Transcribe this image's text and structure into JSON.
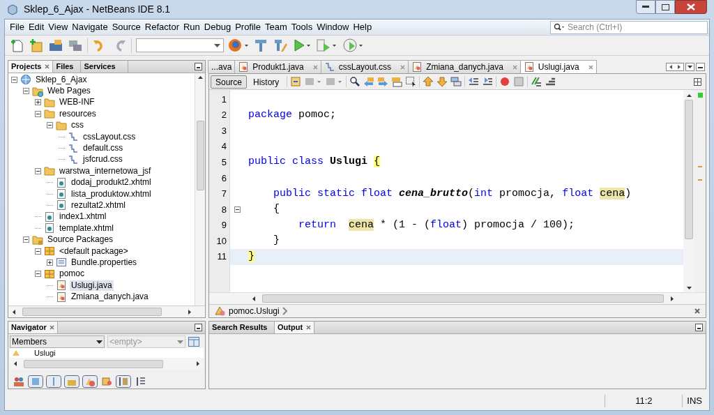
{
  "window": {
    "title": "Sklep_6_Ajax - NetBeans IDE 8.1"
  },
  "menu": [
    "File",
    "Edit",
    "View",
    "Navigate",
    "Source",
    "Refactor",
    "Run",
    "Debug",
    "Profile",
    "Team",
    "Tools",
    "Window",
    "Help"
  ],
  "search": {
    "placeholder": "Search (Ctrl+I)"
  },
  "projects": {
    "tabs": [
      {
        "label": "Projects",
        "selected": true
      },
      {
        "label": "Files",
        "selected": false
      },
      {
        "label": "Services",
        "selected": false
      }
    ],
    "tree": [
      {
        "label": "Sklep_6_Ajax",
        "kind": "project",
        "expanded": true,
        "selected": false,
        "children": [
          {
            "label": "Web Pages",
            "kind": "webroot",
            "expanded": true,
            "selected": false,
            "children": [
              {
                "label": "WEB-INF",
                "kind": "folder",
                "expanded": false,
                "selected": false
              },
              {
                "label": "resources",
                "kind": "folder",
                "expanded": true,
                "selected": false,
                "children": [
                  {
                    "label": "css",
                    "kind": "folder",
                    "expanded": true,
                    "selected": false,
                    "children": [
                      {
                        "label": "cssLayout.css",
                        "kind": "css",
                        "selected": false
                      },
                      {
                        "label": "default.css",
                        "kind": "css",
                        "selected": false
                      },
                      {
                        "label": "jsfcrud.css",
                        "kind": "css",
                        "selected": false
                      }
                    ]
                  }
                ]
              },
              {
                "label": "warstwa_internetowa_jsf",
                "kind": "folder",
                "expanded": true,
                "selected": false,
                "children": [
                  {
                    "label": "dodaj_produkt2.xhtml",
                    "kind": "xhtml",
                    "selected": false
                  },
                  {
                    "label": "lista_produktow.xhtml",
                    "kind": "xhtml",
                    "selected": false
                  },
                  {
                    "label": "rezultat2.xhtml",
                    "kind": "xhtml",
                    "selected": false
                  }
                ]
              },
              {
                "label": "index1.xhtml",
                "kind": "xhtml",
                "selected": false
              },
              {
                "label": "template.xhtml",
                "kind": "xhtml",
                "selected": false
              }
            ]
          },
          {
            "label": "Source Packages",
            "kind": "srcroot",
            "expanded": true,
            "selected": false,
            "children": [
              {
                "label": "<default package>",
                "kind": "package",
                "expanded": true,
                "selected": false,
                "children": [
                  {
                    "label": "Bundle.properties",
                    "kind": "properties",
                    "expanded": false,
                    "selected": false
                  }
                ]
              },
              {
                "label": "pomoc",
                "kind": "package",
                "expanded": true,
                "selected": false,
                "children": [
                  {
                    "label": "Uslugi.java",
                    "kind": "java",
                    "selected": true
                  },
                  {
                    "label": "Zmiana_danych.java",
                    "kind": "java",
                    "selected": false
                  }
                ]
              }
            ]
          }
        ]
      }
    ]
  },
  "editor": {
    "tabs": [
      {
        "label": "...ava",
        "kind": "partial",
        "selected": false
      },
      {
        "label": "Produkt1.java",
        "kind": "java",
        "selected": false
      },
      {
        "label": "cssLayout.css",
        "kind": "css",
        "selected": false
      },
      {
        "label": "Zmiana_danych.java",
        "kind": "java",
        "selected": false
      },
      {
        "label": "Uslugi.java",
        "kind": "java",
        "selected": true
      }
    ],
    "views": [
      {
        "label": "Source",
        "selected": true
      },
      {
        "label": "History",
        "selected": false
      }
    ],
    "lines": [
      {
        "number": "1",
        "selected": false
      },
      {
        "number": "2",
        "selected": false,
        "tokens": [
          {
            "text": "package",
            "kind": "keyword"
          },
          {
            "text": " pomoc;",
            "kind": "plain"
          }
        ]
      },
      {
        "number": "3",
        "selected": false
      },
      {
        "number": "4",
        "selected": false
      },
      {
        "number": "5",
        "selected": false,
        "tokens": [
          {
            "text": "public class ",
            "kind": "keyword"
          },
          {
            "text": "Uslugi ",
            "kind": "bold"
          },
          {
            "text": "{",
            "kind": "match"
          }
        ]
      },
      {
        "number": "6",
        "selected": false
      },
      {
        "number": "7",
        "selected": false,
        "tokens": [
          {
            "text": "    public static float ",
            "kind": "keyword"
          },
          {
            "text": "cena_brutto",
            "kind": "method"
          },
          {
            "text": "(",
            "kind": "plain"
          },
          {
            "text": "int",
            "kind": "keyword"
          },
          {
            "text": " promocja, ",
            "kind": "plain"
          },
          {
            "text": "float ",
            "kind": "keyword"
          },
          {
            "text": "cena",
            "kind": "mark"
          },
          {
            "text": ")",
            "kind": "plain"
          }
        ]
      },
      {
        "number": "8",
        "selected": false,
        "fold": true,
        "tokens": [
          {
            "text": "    {",
            "kind": "plain"
          }
        ]
      },
      {
        "number": "9",
        "selected": false,
        "tokens": [
          {
            "text": "        return  ",
            "kind": "keyword"
          },
          {
            "text": "cena",
            "kind": "mark"
          },
          {
            "text": " * (1 - (",
            "kind": "plain"
          },
          {
            "text": "float",
            "kind": "keyword"
          },
          {
            "text": ") promocja / 100);",
            "kind": "plain"
          }
        ]
      },
      {
        "number": "10",
        "selected": false,
        "tokens": [
          {
            "text": "    }",
            "kind": "plain"
          }
        ]
      },
      {
        "number": "11",
        "selected": true,
        "tokens": [
          {
            "text": "}",
            "kind": "match"
          }
        ]
      }
    ],
    "breadcrumb": "pomoc.Uslugi"
  },
  "navigator": {
    "title": "Navigator",
    "filter": "Members",
    "placeholder": "<empty>",
    "member": "Uslugi"
  },
  "output": {
    "tabs": [
      {
        "label": "Search Results",
        "selected": false
      },
      {
        "label": "Output",
        "selected": true
      }
    ]
  },
  "status_bar": {
    "position": "11:2",
    "mode": "INS"
  }
}
